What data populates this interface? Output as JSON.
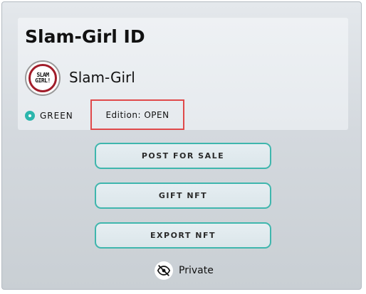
{
  "card": {
    "title": "Slam-Girl ID",
    "avatar_lines": [
      "SLAM",
      "GIRL!"
    ],
    "username": "Slam-Girl",
    "status": {
      "label": "GREEN",
      "color": "#2cb6ad"
    },
    "edition": "Edition: OPEN"
  },
  "actions": {
    "post_for_sale": "POST FOR SALE",
    "gift_nft": "GIFT NFT",
    "export_nft": "EXPORT NFT"
  },
  "privacy": {
    "label": "Private",
    "icon": "eye-off-icon"
  },
  "colors": {
    "accent": "#3fb6ad",
    "highlight_box": "#e0494a",
    "avatar_ring": "#a11d2a"
  }
}
